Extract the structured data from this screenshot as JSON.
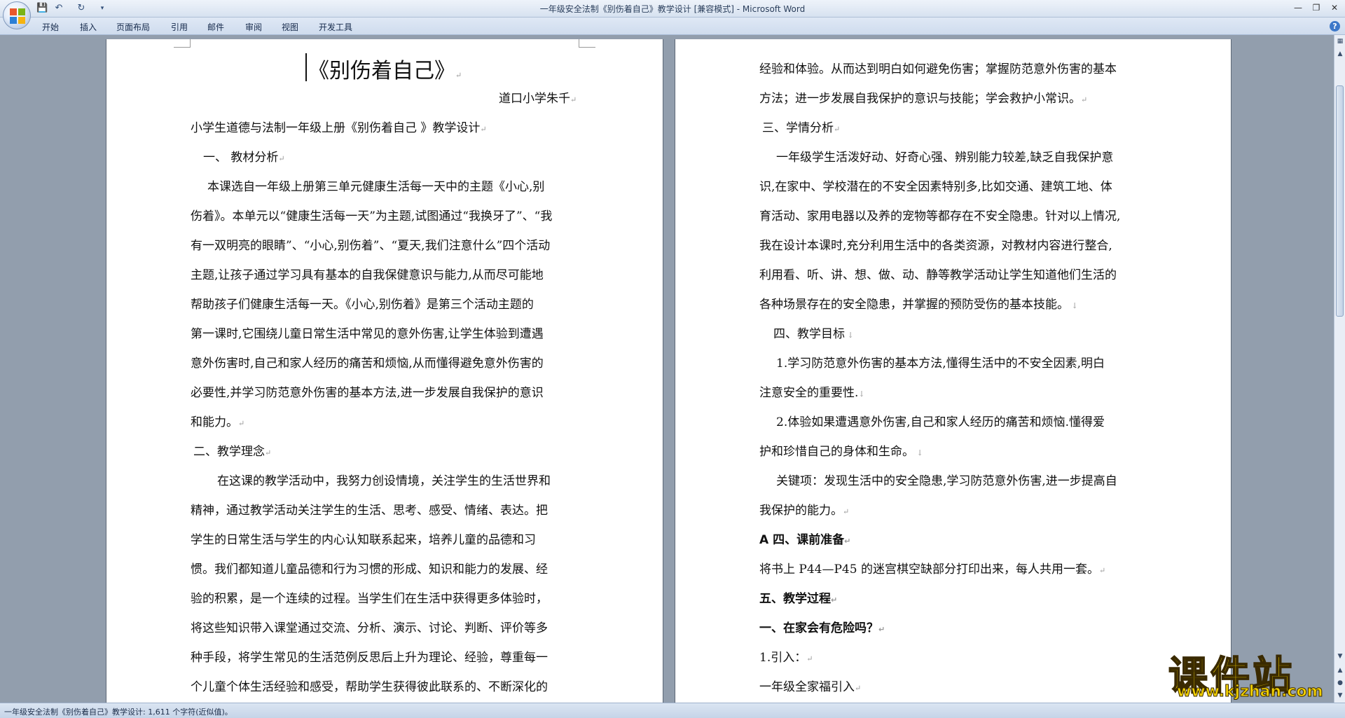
{
  "window": {
    "title": "一年级安全法制《别伤着自己》教学设计 [兼容模式] - Microsoft Word"
  },
  "ribbon": {
    "tabs": [
      "开始",
      "插入",
      "页面布局",
      "引用",
      "邮件",
      "审阅",
      "视图",
      "开发工具"
    ]
  },
  "page1": {
    "lines": [
      "《别伤着自己》",
      "道口小学朱千",
      "小学生道德与法制一年级上册《别伤着自己 》教学设计",
      "一、  教材分析",
      "本课选自一年级上册第三单元健康生活每一天中的主题《小心,别",
      "伤着》。本单元以“健康生活每一天”为主题,试图通过“我换牙了”、“我",
      "有一双明亮的眼睛”、“小心,别伤着”、“夏天,我们注意什么”四个活动",
      "主题,让孩子通过学习具有基本的自我保健意识与能力,从而尽可能地",
      "帮助孩子们健康生活每一天。《小心,别伤着》是第三个活动主题的",
      "第一课时,它围绕儿童日常生活中常见的意外伤害,让学生体验到遭遇",
      "意外伤害时,自己和家人经历的痛苦和烦恼,从而懂得避免意外伤害的",
      "必要性,并学习防范意外伤害的基本方法,进一步发展自我保护的意识",
      "和能力。",
      "二、教学理念",
      "在这课的教学活动中，我努力创设情境，关注学生的生活世界和",
      "精神，通过教学活动关注学生的生活、思考、感受、情绪、表达。把",
      "学生的日常生活与学生的内心认知联系起来，培养儿童的品德和习",
      "惯。我们都知道儿童品德和行为习惯的形成、知识和能力的发展、经",
      "验的积累，是一个连续的过程。当学生们在生活中获得更多体验时，",
      "将这些知识带入课堂通过交流、分析、演示、讨论、判断、评价等多",
      "种手段，将学生常见的生活范例反思后上升为理论、经验，尊重每一",
      "个儿童个体生活经验和感受，帮助学生获得彼此联系的、不断深化的"
    ]
  },
  "page2": {
    "lines": [
      "经验和体验。从而达到明白如何避免伤害；掌握防范意外伤害的基本",
      "方法；进一步发展自我保护的意识与技能；学会救护小常识。",
      "三、学情分析",
      "一年级学生活泼好动、好奇心强、辨别能力较差,缺乏自我保护意",
      "识,在家中、学校潜在的不安全因素特别多,比如交通、建筑工地、体",
      "育活动、家用电器以及养的宠物等都存在不安全隐患。针对以上情况,",
      "我在设计本课时,充分利用生活中的各类资源，对教材内容进行整合,",
      "利用看、听、讲、想、做、动、静等教学活动让学生知道他们生活的",
      "各种场景存在的安全隐患，并掌握的预防受伤的基本技能。",
      "四、教学目标",
      "1.学习防范意外伤害的基本方法,懂得生活中的不安全因素,明白",
      "注意安全的重要性.",
      "2.体验如果遭遇意外伤害,自己和家人经历的痛苦和烦恼.懂得爱",
      "护和珍惜自己的身体和生命。",
      "关键项：发现生活中的安全隐患,学习防范意外伤害,进一步提高自",
      "我保护的能力。",
      "A 四、课前准备",
      "将书上 P44—P45 的迷宫棋空缺部分打印出来，每人共用一套。",
      "五、教学过程",
      "一、在家会有危险吗？",
      "1.引入：",
      "一年级全家福引入"
    ]
  },
  "status": {
    "text": "一年级安全法制《别伤着自己》教学设计: 1,611 个字符(近似值)。"
  },
  "watermark": {
    "brand": "课件站",
    "url": "www.kjzhan.com"
  }
}
